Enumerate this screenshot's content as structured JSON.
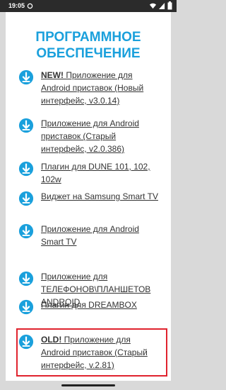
{
  "status": {
    "time": "19:05"
  },
  "page": {
    "title_line1": "ПРОГРАММНОЕ",
    "title_line2": "ОБЕСПЕЧЕНИЕ",
    "accent": "#1aa0dc",
    "highlight_color": "#e0232e"
  },
  "items": [
    {
      "prefix": "NEW!",
      "label": " Приложение для Android приставок (Новый интерфейс, v3.0.14)"
    },
    {
      "prefix": "",
      "label": "Приложение для Android приставок (Старый интерфейс, v2.0.386)"
    },
    {
      "prefix": "",
      "label": "Плагин для DUNE 101, 102, 102w"
    },
    {
      "prefix": "",
      "label": "Виджет на Samsung Smart TV"
    },
    {
      "prefix": "",
      "label": "Приложение для Android Smart TV"
    },
    {
      "prefix": "",
      "label": "Приложение для ТЕЛЕФОНОВ\\ПЛАНШЕТОВ ANDROID"
    },
    {
      "prefix": "",
      "label": "Плагин для DREAMBOX"
    },
    {
      "prefix": "OLD!",
      "label": " Приложение для Android приставок (Старый интерфейс, v.2.81)"
    }
  ]
}
